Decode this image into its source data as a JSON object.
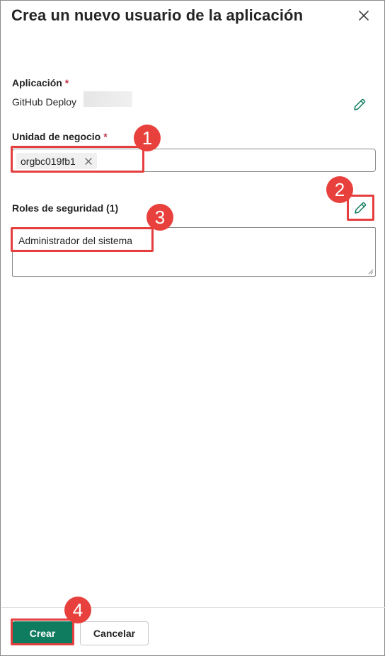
{
  "dialog": {
    "title": "Crea un nuevo usuario de la aplicación",
    "close_icon": "close-icon"
  },
  "application": {
    "label": "Aplicación",
    "required_marker": "*",
    "value": "GitHub Deploy",
    "edit_icon": "pencil-icon"
  },
  "business_unit": {
    "label": "Unidad de negocio",
    "required_marker": "*",
    "chip_value": "orgbc019fb1",
    "remove_icon": "close-icon"
  },
  "security_roles": {
    "label": "Roles de seguridad (1)",
    "edit_icon": "pencil-icon",
    "items": [
      "Administrador del sistema"
    ]
  },
  "footer": {
    "primary_label": "Crear",
    "secondary_label": "Cancelar"
  },
  "annotations": {
    "badges": [
      "1",
      "2",
      "3",
      "4"
    ],
    "highlight_color": "#e53e3e"
  },
  "colors": {
    "accent": "#0f7b5f",
    "required": "#c4314b",
    "badge": "#e8413d"
  }
}
